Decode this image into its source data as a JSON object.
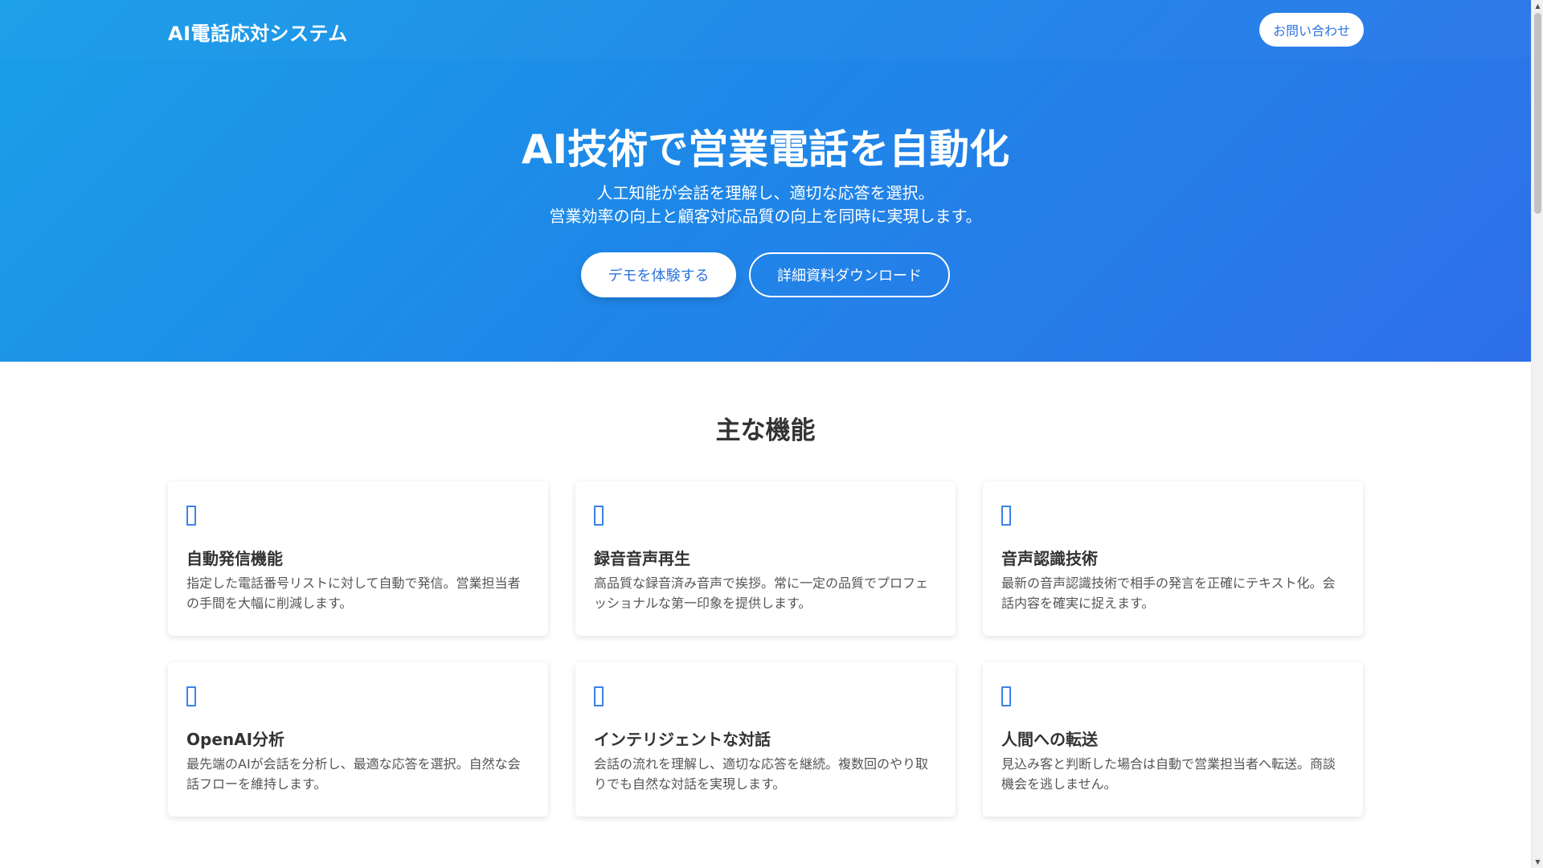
{
  "header": {
    "brand": "AI電話応対システム",
    "contact_label": "お問い合わせ"
  },
  "hero": {
    "title": "AI技術で営業電話を自動化",
    "subtitle_lines": [
      "人工知能が会話を理解し、適切な応答を選択。",
      "営業効率の向上と顧客対応品質の向上を同時に実現します。"
    ],
    "primary_button": "デモを体験する",
    "secondary_button": "詳細資料ダウンロード"
  },
  "features": {
    "title": "主な機能",
    "cards": [
      {
        "icon": "auto-call-icon",
        "title": "自動発信機能",
        "description": "指定した電話番号リストに対して自動で発信。営業担当者の手間を大幅に削減します。"
      },
      {
        "icon": "recorded-audio-icon",
        "title": "録音音声再生",
        "description": "高品質な録音済み音声で挨拶。常に一定の品質でプロフェッショナルな第一印象を提供します。"
      },
      {
        "icon": "speech-recognition-icon",
        "title": "音声認識技術",
        "description": "最新の音声認識技術で相手の発言を正確にテキスト化。会話内容を確実に捉えます。"
      },
      {
        "icon": "ai-analysis-icon",
        "title": "OpenAI分析",
        "description": "最先端のAIが会話を分析し、最適な応答を選択。自然な会話フローを維持します。"
      },
      {
        "icon": "dialogue-icon",
        "title": "インテリジェントな対話",
        "description": "会話の流れを理解し、適切な応答を継続。複数回のやり取りでも自然な対話を実現します。"
      },
      {
        "icon": "transfer-icon",
        "title": "人間への転送",
        "description": "見込み客と判断した場合は自動で営業担当者へ転送。商談機会を逃しません。"
      }
    ]
  },
  "colors": {
    "hero_gradient_start": "#1a9fe8",
    "hero_gradient_end": "#2f6fe9",
    "accent": "#2c74e0",
    "icon": "#3b82e6"
  }
}
